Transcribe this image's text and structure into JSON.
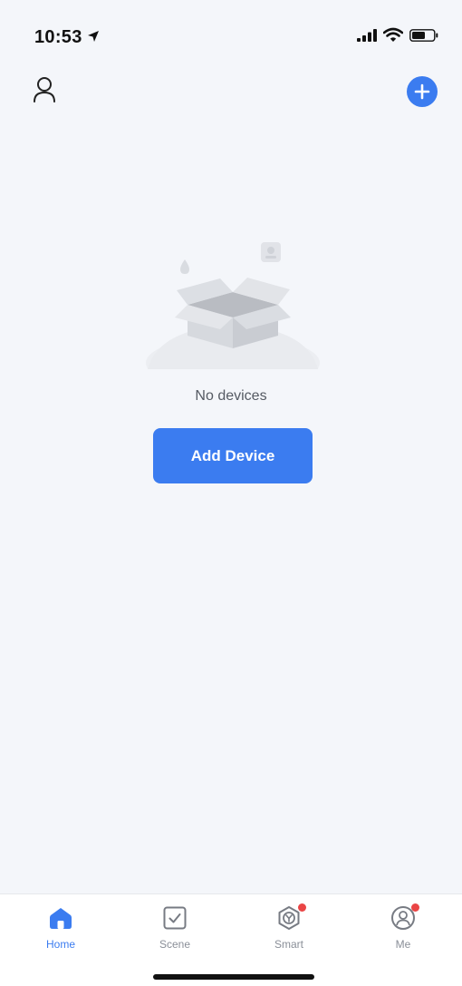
{
  "status_bar": {
    "time": "10:53"
  },
  "icons": {
    "account": "user-icon",
    "add": "plus-icon",
    "location": "location-arrow-icon",
    "signal": "signal-icon",
    "wifi": "wifi-icon",
    "battery": "battery-icon"
  },
  "empty_state": {
    "message": "No devices",
    "button_label": "Add Device"
  },
  "tabs": [
    {
      "label": "Home",
      "icon": "home-icon",
      "active": true,
      "badge": false
    },
    {
      "label": "Scene",
      "icon": "scene-check-icon",
      "active": false,
      "badge": false
    },
    {
      "label": "Smart",
      "icon": "smart-hex-icon",
      "active": false,
      "badge": true
    },
    {
      "label": "Me",
      "icon": "profile-icon",
      "active": false,
      "badge": true
    }
  ],
  "colors": {
    "accent": "#3b7cf0",
    "background": "#f4f6fa",
    "badge": "#ea4545",
    "inactive_tab": "#8a8f98"
  }
}
